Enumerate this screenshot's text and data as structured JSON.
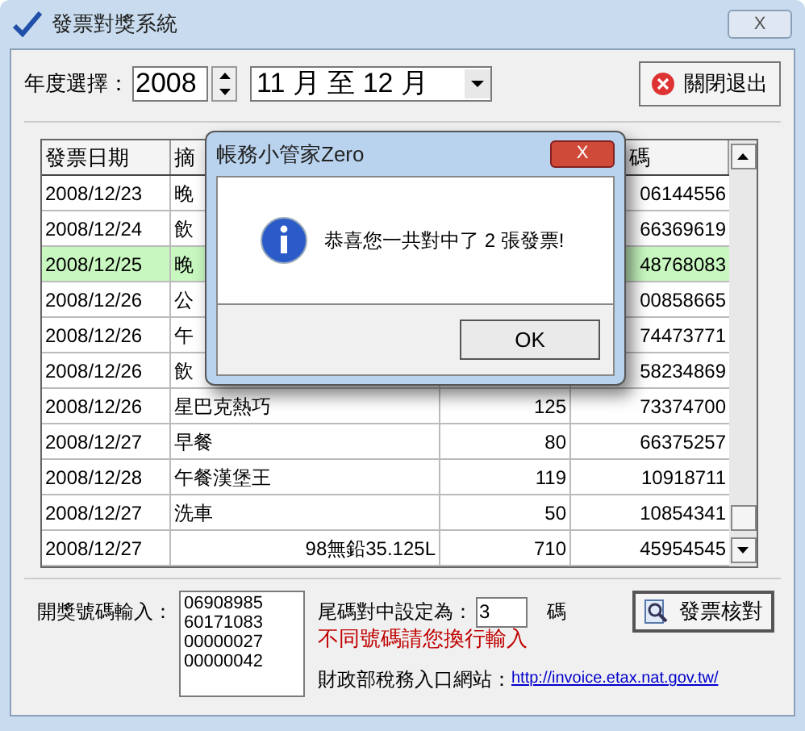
{
  "window": {
    "title": "發票對獎系統",
    "close": "X"
  },
  "toolbar": {
    "year_label": "年度選擇：",
    "year": "2008",
    "period": "11 月 至 12 月",
    "exit_button": "關閉退出"
  },
  "table": {
    "columns": [
      "發票日期",
      "摘",
      "碼"
    ],
    "rows": [
      {
        "date": "2008/12/23",
        "desc": "晚",
        "number": "06144556",
        "highlighted": false,
        "right_aligned": false
      },
      {
        "date": "2008/12/24",
        "desc": "飲",
        "number": "66369619",
        "highlighted": false,
        "right_aligned": false
      },
      {
        "date": "2008/12/25",
        "desc": "晚",
        "number": "48768083",
        "highlighted": true,
        "right_aligned": false
      },
      {
        "date": "2008/12/26",
        "desc": "公",
        "number": "00858665",
        "highlighted": false,
        "right_aligned": false
      },
      {
        "date": "2008/12/26",
        "desc": "午",
        "number": "74473771",
        "highlighted": false,
        "right_aligned": false
      },
      {
        "date": "2008/12/26",
        "desc": "飲",
        "number": "58234869",
        "highlighted": false,
        "right_aligned": false
      },
      {
        "date": "2008/12/26",
        "desc": "星巴克熱巧",
        "amount": "125",
        "number": "73374700",
        "highlighted": false,
        "right_aligned": false
      },
      {
        "date": "2008/12/27",
        "desc": "早餐",
        "amount": "80",
        "number": "66375257",
        "highlighted": false,
        "right_aligned": false
      },
      {
        "date": "2008/12/28",
        "desc": "午餐漢堡王",
        "amount": "119",
        "number": "10918711",
        "highlighted": false,
        "right_aligned": false
      },
      {
        "date": "2008/12/27",
        "desc": "洗車",
        "amount": "50",
        "number": "10854341",
        "highlighted": false,
        "right_aligned": false
      },
      {
        "date": "2008/12/27",
        "desc": "98無鉛35.125L",
        "amount": "710",
        "number": "45954545",
        "highlighted": false,
        "right_aligned": true
      }
    ]
  },
  "bottom": {
    "input_label": "開獎號碼輸入：",
    "numbers": [
      "06908985",
      "60171083",
      "00000027",
      "00000042"
    ],
    "tail_label": "尾碼對中設定為：",
    "tail_value": "3",
    "tail_unit": "碼",
    "hint": "不同號碼請您換行輸入",
    "site_label": "財政部稅務入口網站：",
    "site_link": "http://invoice.etax.nat.gov.tw/",
    "check_button": "發票核對"
  },
  "dialog": {
    "title": "帳務小管家Zero",
    "close": "X",
    "message": "恭喜您一共對中了 2 張發票!",
    "ok": "OK"
  }
}
